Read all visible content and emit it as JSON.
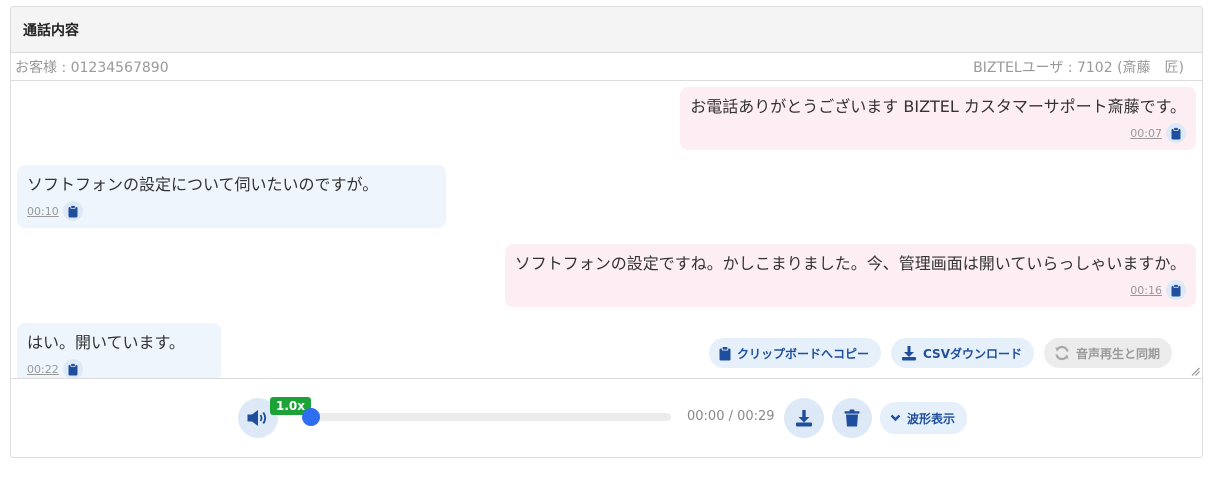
{
  "panel": {
    "title": "通話内容"
  },
  "meta": {
    "customer": "お客様 : 01234567890",
    "agent": "BIZTELユーザ : 7102 (斎藤　匠)"
  },
  "messages": [
    {
      "speaker": "agent",
      "text": "お電話ありがとうございます BIZTEL カスタマーサポート斎藤です。",
      "time": "00:07"
    },
    {
      "speaker": "customer",
      "text": "ソフトフォンの設定について伺いたいのですが。",
      "time": "00:10"
    },
    {
      "speaker": "agent",
      "text": "ソフトフォンの設定ですね。かしこまりました。今、管理画面は開いていらっしゃいますか。",
      "time": "00:16"
    },
    {
      "speaker": "customer",
      "text": "はい。開いています。",
      "time": "00:22"
    }
  ],
  "toolbar": {
    "copy_label": "クリップボードへコピー",
    "csv_label": "CSVダウンロード",
    "sync_label": "音声再生と同期"
  },
  "player": {
    "speed": "1.0x",
    "time_text": "00:00 / 00:29",
    "progress": 0.0,
    "waveform_label": "波形表示"
  },
  "colors": {
    "accent": "#2f6ef0",
    "agent_bubble": "#fdeef3",
    "customer_bubble": "#eef5fc",
    "speed_badge": "#1da238",
    "icon": "#1f4f9c"
  },
  "icons": [
    "clipboard-icon",
    "download-icon",
    "sync-icon",
    "volume-icon",
    "trash-icon",
    "chevron-down-icon",
    "resize-grip-icon"
  ]
}
